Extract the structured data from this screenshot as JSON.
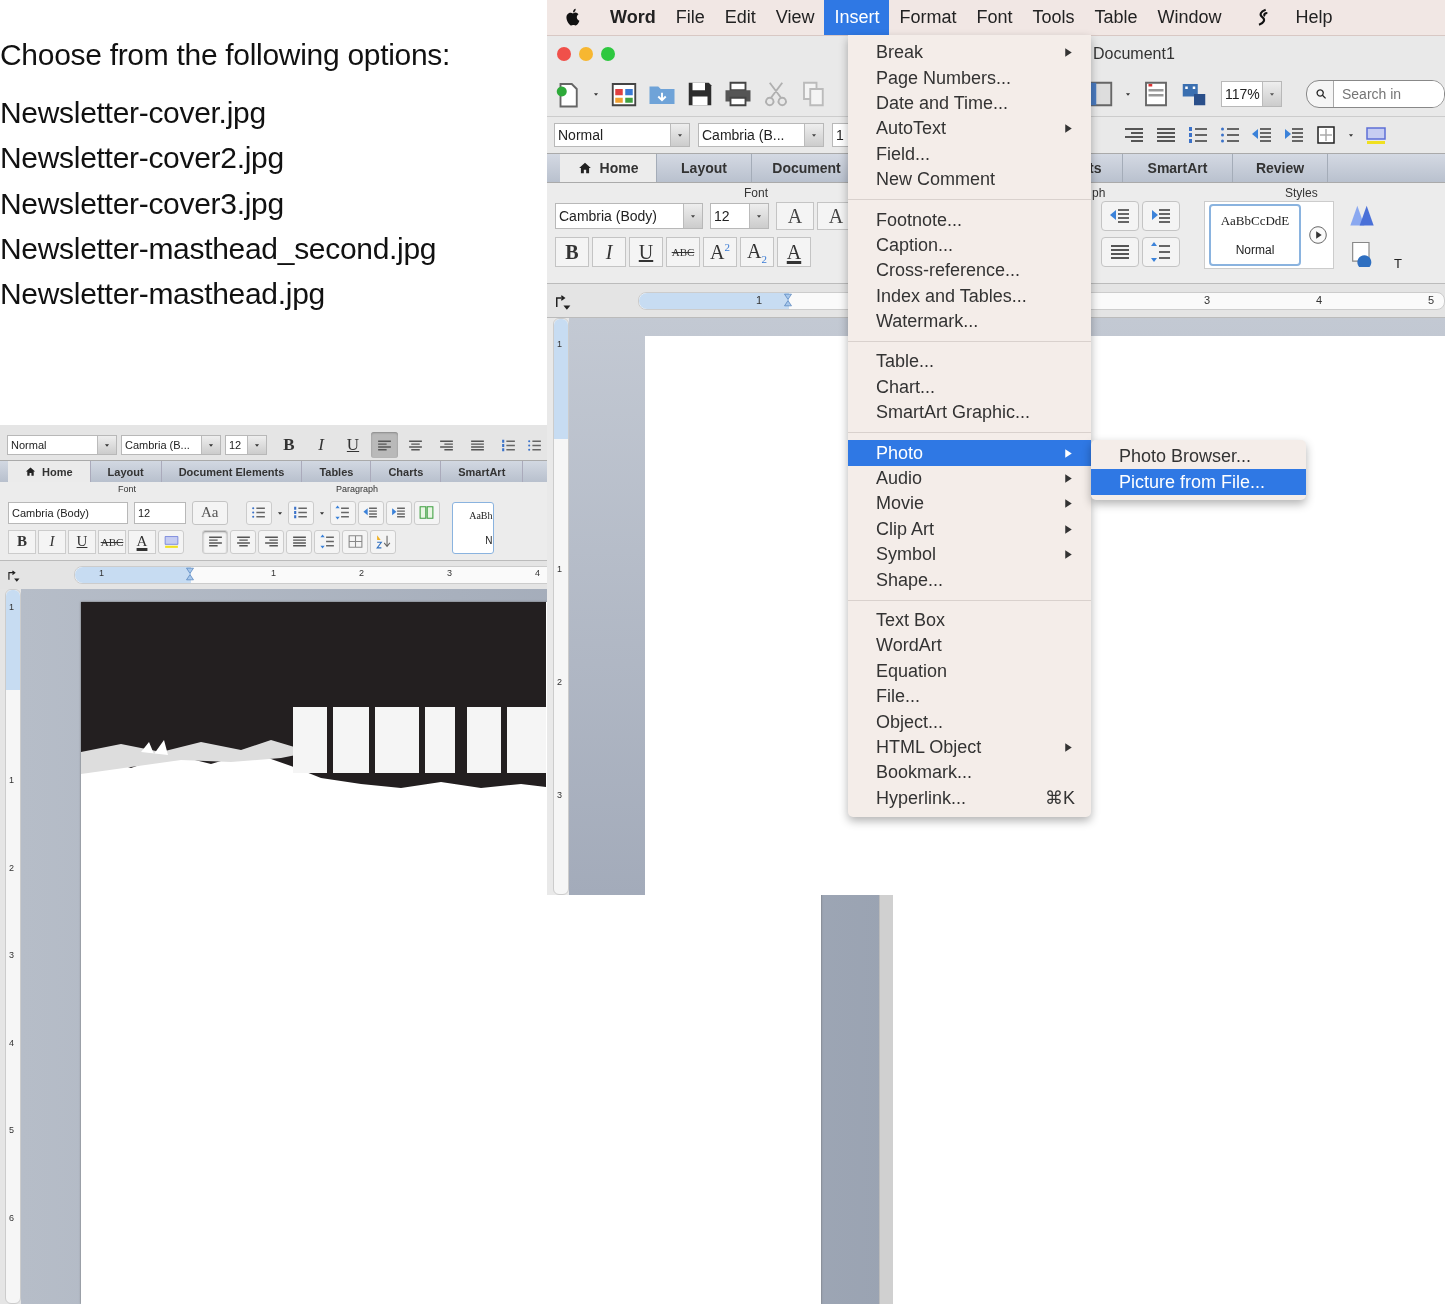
{
  "prompt": {
    "title": "Choose from the following options:",
    "options": [
      "Newsletter-cover.jpg",
      "Newsletter-cover2.jpg",
      "Newsletter-cover3.jpg",
      "Newsletter-masthead_second.jpg",
      "Newsletter-masthead.jpg"
    ]
  },
  "back_window": {
    "format_bar": {
      "style": "Normal",
      "font": "Cambria (B...",
      "size": "12",
      "buttons": [
        {
          "label": "B",
          "kind": "bold"
        },
        {
          "label": "I",
          "kind": "italic"
        },
        {
          "label": "U",
          "kind": "underline"
        }
      ]
    },
    "tabs": [
      {
        "label": "Home",
        "selected": true
      },
      {
        "label": "Layout",
        "selected": false
      },
      {
        "label": "Document Elements",
        "selected": false
      },
      {
        "label": "Tables",
        "selected": false
      },
      {
        "label": "Charts",
        "selected": false
      },
      {
        "label": "SmartArt",
        "selected": false
      }
    ],
    "ribbon": {
      "groups": [
        "Font",
        "Paragraph"
      ],
      "font": "Cambria (Body)",
      "size": "12",
      "case_button": "Aa",
      "buttons": [
        {
          "label": "B",
          "kind": "bold"
        },
        {
          "label": "I",
          "kind": "italic"
        },
        {
          "label": "U",
          "kind": "underline"
        },
        {
          "label": "ABC",
          "kind": "strike"
        },
        {
          "label": "A",
          "kind": "color"
        }
      ],
      "style_sample": "AaBh",
      "style_name": "N"
    },
    "ruler": {
      "left_labels": [
        "1"
      ],
      "labels": [
        "1",
        "2",
        "3",
        "4"
      ]
    },
    "vertical_ruler": {
      "top_label": "1",
      "labels": [
        "1",
        "2",
        "3",
        "4",
        "5",
        "6"
      ]
    }
  },
  "front_window": {
    "menu_bar": [
      {
        "label": "Word",
        "selected": false
      },
      {
        "label": "File",
        "selected": false
      },
      {
        "label": "Edit",
        "selected": false
      },
      {
        "label": "View",
        "selected": false
      },
      {
        "label": "Insert",
        "selected": true
      },
      {
        "label": "Format",
        "selected": false
      },
      {
        "label": "Font",
        "selected": false
      },
      {
        "label": "Tools",
        "selected": false
      },
      {
        "label": "Table",
        "selected": false
      },
      {
        "label": "Window",
        "selected": false
      },
      {
        "label": "Help",
        "selected": false
      }
    ],
    "title": "Document1",
    "zoom": "117%",
    "search": {
      "placeholder": "Search in"
    },
    "format_bar": {
      "style": "Normal",
      "font": "Cambria (B...",
      "size": "1"
    },
    "tabs": [
      {
        "label": "Home",
        "selected": true
      },
      {
        "label": "Layout",
        "selected": false
      },
      {
        "label": "Document",
        "selected": false
      },
      {
        "label": "ts",
        "selected": false
      },
      {
        "label": "SmartArt",
        "selected": false
      },
      {
        "label": "Review",
        "selected": false
      }
    ],
    "ribbon": {
      "groups": [
        "Font",
        "ph",
        "Styles"
      ],
      "font": "Cambria (Body)",
      "size": "12",
      "grow_buttons": [
        "A",
        "A"
      ],
      "buttons": [
        {
          "label": "B",
          "kind": "bold"
        },
        {
          "label": "I",
          "kind": "italic"
        },
        {
          "label": "U",
          "kind": "underline"
        },
        {
          "label": "ABC",
          "kind": "strike"
        },
        {
          "label": "A$^{2}$",
          "kind": "super"
        },
        {
          "label": "A$_{2}$",
          "kind": "sub"
        },
        {
          "label": "A",
          "kind": "color"
        }
      ],
      "style_sample": "AaBbCcDdE",
      "style_name": "Normal",
      "cut_label": "T"
    },
    "ruler": {
      "left_labels": [
        "1"
      ],
      "labels": [
        "3",
        "4",
        "5"
      ]
    },
    "vertical_ruler": {
      "top_label": "1",
      "labels": [
        "1",
        "2",
        "3"
      ]
    }
  },
  "insert_menu": {
    "sections": [
      [
        {
          "label": "Break",
          "submenu": true,
          "selected": false
        },
        {
          "label": "Page Numbers...",
          "submenu": false,
          "selected": false
        },
        {
          "label": "Date and Time...",
          "submenu": false,
          "selected": false
        },
        {
          "label": "AutoText",
          "submenu": true,
          "selected": false
        },
        {
          "label": "Field...",
          "submenu": false,
          "selected": false
        },
        {
          "label": "New Comment",
          "submenu": false,
          "selected": false
        }
      ],
      [
        {
          "label": "Footnote...",
          "submenu": false,
          "selected": false
        },
        {
          "label": "Caption...",
          "submenu": false,
          "selected": false
        },
        {
          "label": "Cross-reference...",
          "submenu": false,
          "selected": false
        },
        {
          "label": "Index and Tables...",
          "submenu": false,
          "selected": false
        },
        {
          "label": "Watermark...",
          "submenu": false,
          "selected": false
        }
      ],
      [
        {
          "label": "Table...",
          "submenu": false,
          "selected": false
        },
        {
          "label": "Chart...",
          "submenu": false,
          "selected": false
        },
        {
          "label": "SmartArt Graphic...",
          "submenu": false,
          "selected": false
        }
      ],
      [
        {
          "label": "Photo",
          "submenu": true,
          "selected": true
        },
        {
          "label": "Audio",
          "submenu": true,
          "selected": false
        },
        {
          "label": "Movie",
          "submenu": true,
          "selected": false
        },
        {
          "label": "Clip Art",
          "submenu": true,
          "selected": false
        },
        {
          "label": "Symbol",
          "submenu": true,
          "selected": false
        },
        {
          "label": "Shape...",
          "submenu": false,
          "selected": false
        }
      ],
      [
        {
          "label": "Text Box",
          "submenu": false,
          "selected": false
        },
        {
          "label": "WordArt",
          "submenu": false,
          "selected": false
        },
        {
          "label": "Equation",
          "submenu": false,
          "selected": false
        },
        {
          "label": "File...",
          "submenu": false,
          "selected": false
        },
        {
          "label": "Object...",
          "submenu": false,
          "selected": false
        },
        {
          "label": "HTML Object",
          "submenu": true,
          "selected": false
        },
        {
          "label": "Bookmark...",
          "submenu": false,
          "selected": false
        },
        {
          "label": "Hyperlink...",
          "submenu": false,
          "selected": false,
          "shortcut": "⌘K"
        }
      ]
    ]
  },
  "photo_submenu": [
    {
      "label": "Photo Browser...",
      "selected": false
    },
    {
      "label": "Picture from File...",
      "selected": true
    }
  ]
}
